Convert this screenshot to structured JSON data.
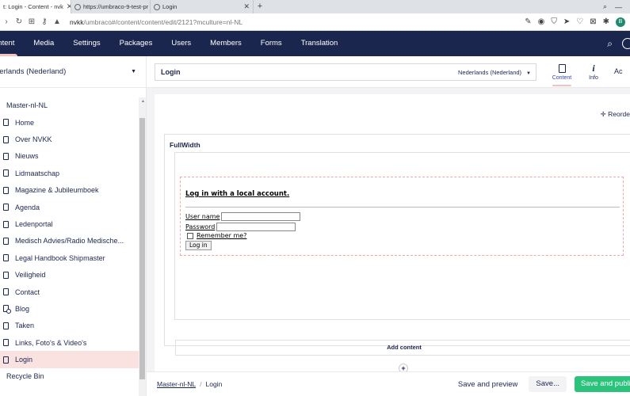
{
  "browser": {
    "tabs": [
      {
        "title": "t: Login - Content - nvk",
        "active": true
      },
      {
        "title": "https://umbraco-9-test-pr",
        "active": false
      },
      {
        "title": "Login",
        "active": false
      }
    ],
    "url_host": "nvkk",
    "url_path": "/umbraco#/content/content/edit/2121?mculture=nl-NL"
  },
  "header": {
    "nav": [
      "ontent",
      "Media",
      "Settings",
      "Packages",
      "Users",
      "Members",
      "Forms",
      "Translation"
    ]
  },
  "sidebar": {
    "language": "derlands (Nederland)",
    "root": "Master-nl-NL",
    "items": [
      {
        "label": "Home",
        "icon": "document-icon"
      },
      {
        "label": "Over NVKK",
        "icon": "document-icon"
      },
      {
        "label": "Nieuws",
        "icon": "document-icon"
      },
      {
        "label": "Lidmaatschap",
        "icon": "document-icon"
      },
      {
        "label": "Magazine & Jubileumboek",
        "icon": "document-icon"
      },
      {
        "label": "Agenda",
        "icon": "document-icon"
      },
      {
        "label": "Ledenportal",
        "icon": "document-icon"
      },
      {
        "label": "Medisch Advies/Radio Medische...",
        "icon": "document-icon"
      },
      {
        "label": "Legal Handbook Shipmaster",
        "icon": "document-icon"
      },
      {
        "label": "Veiligheid",
        "icon": "document-icon"
      },
      {
        "label": "Contact",
        "icon": "document-icon"
      },
      {
        "label": "Blog",
        "icon": "document-link-icon"
      },
      {
        "label": "Taken",
        "icon": "document-icon"
      },
      {
        "label": "Links, Foto's & Video's",
        "icon": "document-icon"
      },
      {
        "label": "Login",
        "icon": "document-icon",
        "selected": true
      }
    ],
    "recycle_bin": "Recycle Bin"
  },
  "editor": {
    "name": "Login",
    "culture": "Nederlands (Nederland)",
    "apps": [
      {
        "label": "Content",
        "active": true
      },
      {
        "label": "Info",
        "active": false
      },
      {
        "label": "Ac",
        "active": false
      }
    ],
    "reorder": "Reorde",
    "fullwidth": "FullWidth",
    "login_title": "Log in with a local account.",
    "username_label": "User name",
    "password_label": "Password",
    "remember_label": "Remember me?",
    "login_button": "Log in",
    "add_content": "Add content",
    "add_plus": "+"
  },
  "footer": {
    "crumb_root": "Master-nl-NL",
    "crumb_sep": "/",
    "crumb_current": "Login",
    "save_preview": "Save and preview",
    "save": "Save...",
    "save_publish": "Save and publis"
  },
  "colors": {
    "header_bg": "#1b264f",
    "selected_bg": "#f9e2e0",
    "publish_bg": "#2bc37c"
  }
}
